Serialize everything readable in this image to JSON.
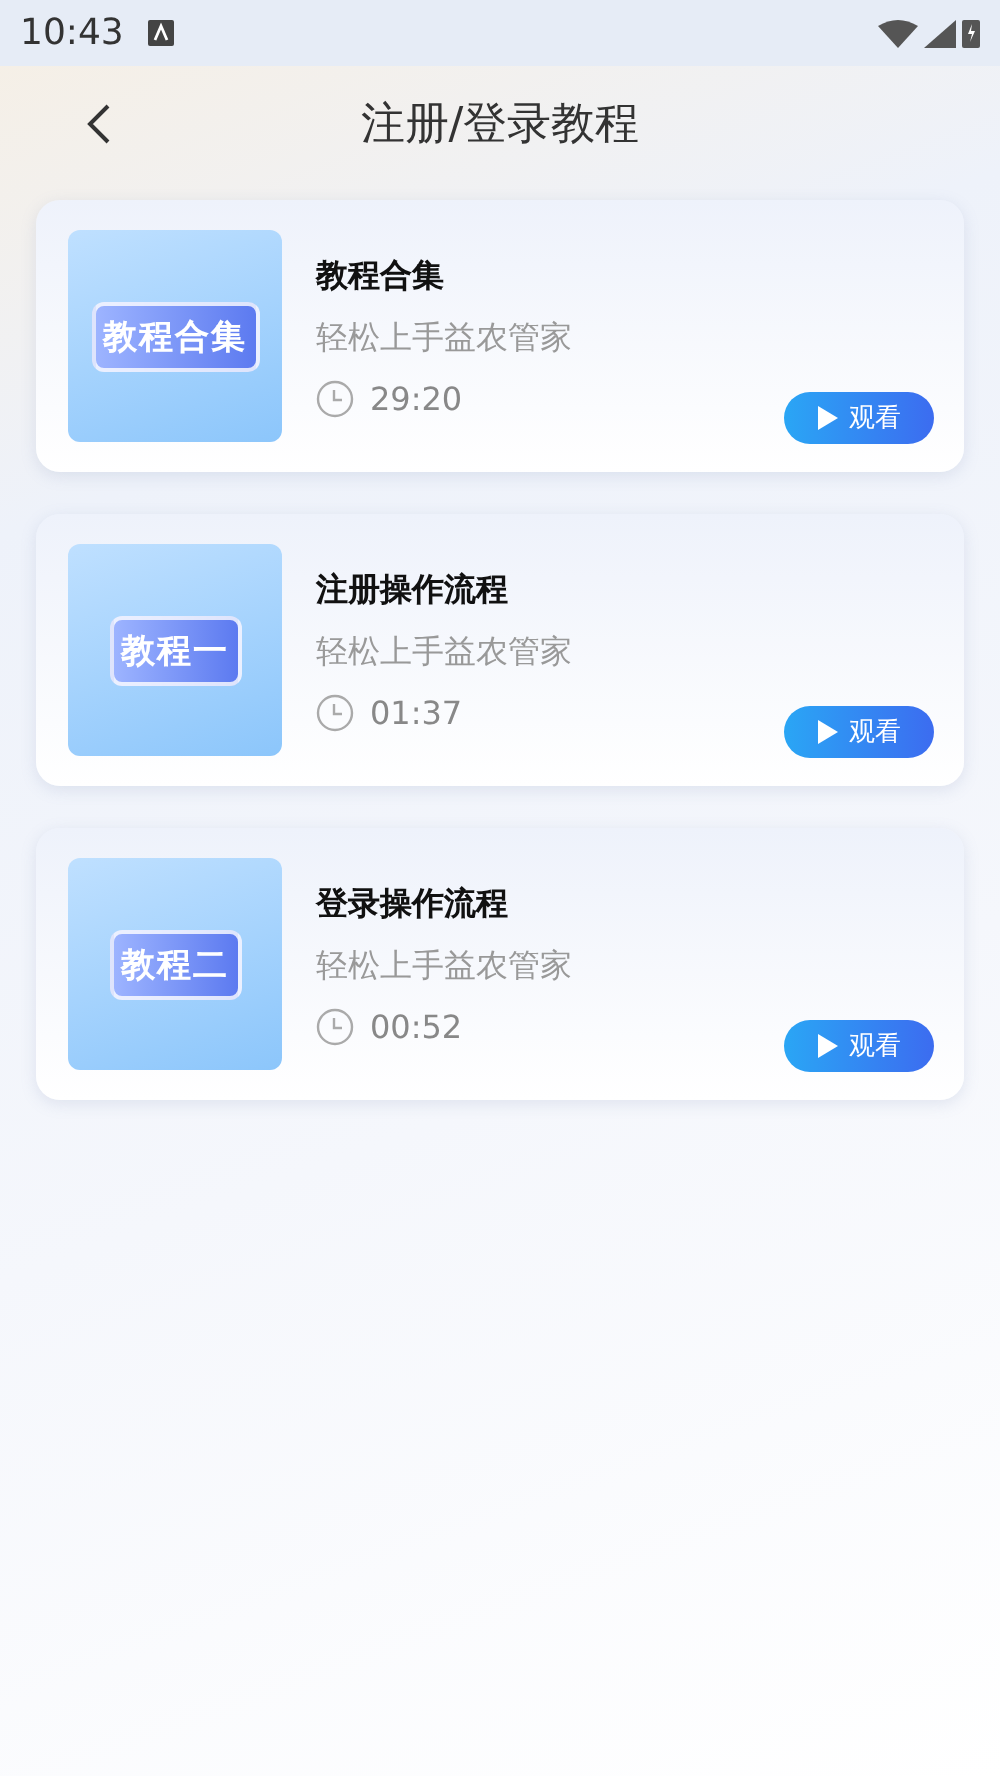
{
  "status_bar": {
    "time": "10:43"
  },
  "header": {
    "title": "注册/登录教程"
  },
  "tutorials": [
    {
      "thumbnail_text": "教程合集",
      "title": "教程合集",
      "subtitle": "轻松上手益农管家",
      "duration": "29:20",
      "button": "观看"
    },
    {
      "thumbnail_text": "教程一",
      "title": "注册操作流程",
      "subtitle": "轻松上手益农管家",
      "duration": "01:37",
      "button": "观看"
    },
    {
      "thumbnail_text": "教程二",
      "title": "登录操作流程",
      "subtitle": "轻松上手益农管家",
      "duration": "00:52",
      "button": "观看"
    }
  ]
}
